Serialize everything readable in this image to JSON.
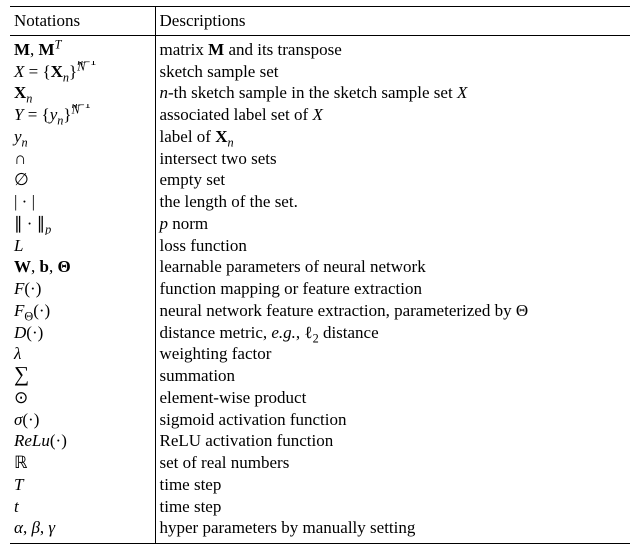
{
  "table": {
    "headers": {
      "notations": "Notations",
      "descriptions": "Descriptions"
    },
    "rows": [
      {
        "notation_html": "<span class='bf'>M</span>, <span class='bf'>M</span><sup><span class='it'>T</span></sup>",
        "description_html": "matrix <span class='bf'>M</span> and its transpose"
      },
      {
        "notation_html": "<span class='cal'>X</span> = {<span class='bf'>X</span><sub><span class='it'>n</span></sub>}<span style='position:relative'><sup><span class='it'>N</span></sup><sub style='position:absolute;left:0'><span class='it'>n</span>=1</sub></span>",
        "description_html": "sketch sample set"
      },
      {
        "notation_html": "<span class='bf'>X</span><sub><span class='it'>n</span></sub>",
        "description_html": "<span class='it'>n</span>-th sketch sample in the sketch sample set <span class='cal'>X</span>"
      },
      {
        "notation_html": "<span class='cal'>Y</span> = {<span class='it'>y</span><sub><span class='it'>n</span></sub>}<span style='position:relative'><sup><span class='it'>N</span></sup><sub style='position:absolute;left:0'><span class='it'>n</span>=1</sub></span>",
        "description_html": "associated label set of <span class='cal'>X</span>"
      },
      {
        "notation_html": "<span class='it'>y</span><sub><span class='it'>n</span></sub>",
        "description_html": "label of <span class='bf'>X</span><sub><span class='it'>n</span></sub>"
      },
      {
        "notation_html": "∩",
        "description_html": "intersect two sets"
      },
      {
        "notation_html": "∅",
        "description_html": "empty set"
      },
      {
        "notation_html": "| · |",
        "description_html": "the length of the set."
      },
      {
        "notation_html": "∥ · ∥<sub><span class='it'>p</span></sub>",
        "description_html": "<span class='it'>p</span> norm"
      },
      {
        "notation_html": "<span class='cal'>L</span>",
        "description_html": "loss function"
      },
      {
        "notation_html": "<span class='bf'>W</span>, <span class='bf'>b</span>, <span class='bf'>Θ</span>",
        "description_html": "learnable parameters of neural network"
      },
      {
        "notation_html": "<span class='cal'>F</span>(·)",
        "description_html": "function mapping or feature extraction"
      },
      {
        "notation_html": "<span class='cal'>F</span><sub>Θ</sub>(·)",
        "description_html": "neural network feature extraction, parameterized by Θ"
      },
      {
        "notation_html": "<span class='cal'>D</span>(·)",
        "description_html": "distance metric, <span class='it'>e.g.</span>, ℓ<sub>2</sub> distance"
      },
      {
        "notation_html": "<span class='it'>λ</span>",
        "description_html": "weighting factor"
      },
      {
        "notation_html": "<span style='font-size:1.25em;line-height:0'>∑</span>",
        "description_html": "summation"
      },
      {
        "notation_html": "⊙",
        "description_html": "element-wise product"
      },
      {
        "notation_html": "<span class='it'>σ</span>(·)",
        "description_html": "sigmoid activation function"
      },
      {
        "notation_html": "<span class='it'>ReLu</span>(·)",
        "description_html": "ReLU activation function"
      },
      {
        "notation_html": "<span class='bb'>ℝ</span>",
        "description_html": "set of real numbers"
      },
      {
        "notation_html": "<span class='it'>T</span>",
        "description_html": "time step"
      },
      {
        "notation_html": "<span class='it'>t</span>",
        "description_html": "time step"
      },
      {
        "notation_html": "<span class='it'>α</span>, <span class='it'>β</span>, <span class='it'>γ</span>",
        "description_html": "hyper parameters by manually setting"
      }
    ]
  }
}
